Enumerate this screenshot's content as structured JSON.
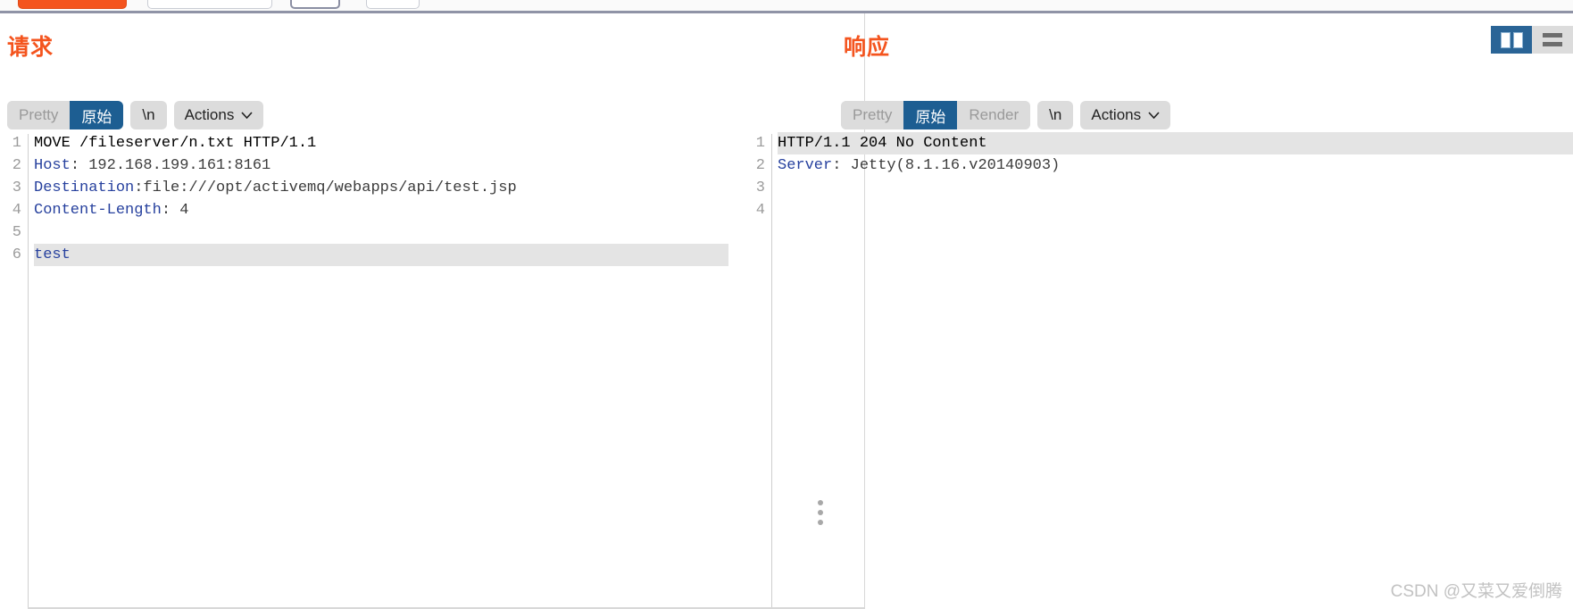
{
  "top_toolbar": {
    "buttons": [
      {
        "name": "send-button",
        "style": "primary"
      },
      {
        "name": "cancel-button",
        "style": "normal"
      },
      {
        "name": "prev-button",
        "style": "selected"
      },
      {
        "name": "next-button",
        "style": "normal"
      }
    ]
  },
  "view_toggle": {
    "split_icon": "split-view-icon",
    "rows_icon": "stacked-view-icon",
    "active": "split"
  },
  "request": {
    "title": "请求",
    "toolbar": {
      "pretty_label": "Pretty",
      "raw_label": "原始",
      "newline_label": "\\n",
      "actions_label": "Actions",
      "active_tab": "原始"
    },
    "line_numbers": [
      "1",
      "2",
      "3",
      "4",
      "5",
      "6"
    ],
    "lines": [
      {
        "segments": [
          {
            "text": "MOVE /fileserver/n.txt HTTP/1.1",
            "kind": "plain"
          }
        ],
        "highlight": false
      },
      {
        "segments": [
          {
            "text": "Host",
            "kind": "header"
          },
          {
            "text": ": 192.168.199.161:8161",
            "kind": "value"
          }
        ],
        "highlight": false
      },
      {
        "segments": [
          {
            "text": "Destination",
            "kind": "header"
          },
          {
            "text": ":file:///opt/activemq/webapps/api/test.jsp",
            "kind": "value"
          }
        ],
        "highlight": false
      },
      {
        "segments": [
          {
            "text": "Content-Length",
            "kind": "header"
          },
          {
            "text": ": 4",
            "kind": "value"
          }
        ],
        "highlight": false
      },
      {
        "segments": [
          {
            "text": "",
            "kind": "plain"
          }
        ],
        "highlight": false
      },
      {
        "segments": [
          {
            "text": "test",
            "kind": "body"
          }
        ],
        "highlight": true
      }
    ]
  },
  "response": {
    "title": "响应",
    "toolbar": {
      "pretty_label": "Pretty",
      "raw_label": "原始",
      "render_label": "Render",
      "newline_label": "\\n",
      "actions_label": "Actions",
      "active_tab": "原始"
    },
    "line_numbers": [
      "1",
      "2",
      "3",
      "4"
    ],
    "lines": [
      {
        "segments": [
          {
            "text": "HTTP/1.1 204 No Content",
            "kind": "plain"
          }
        ],
        "highlight": true
      },
      {
        "segments": [
          {
            "text": "Server",
            "kind": "header"
          },
          {
            "text": ": Jetty(8.1.16.v20140903)",
            "kind": "value"
          }
        ],
        "highlight": false
      },
      {
        "segments": [
          {
            "text": "",
            "kind": "plain"
          }
        ],
        "highlight": false
      },
      {
        "segments": [
          {
            "text": "",
            "kind": "plain"
          }
        ],
        "highlight": false
      }
    ]
  },
  "drag_handle": {
    "name": "panel-resize-handle"
  },
  "watermark": {
    "text": "CSDN @又菜又爱倒腾"
  },
  "colors": {
    "accent_orange": "#f4541e",
    "active_blue": "#1d5e92",
    "header_blue": "#27419e",
    "pill_bg": "#dcdcdc",
    "highlight": "#e4e4e4"
  }
}
